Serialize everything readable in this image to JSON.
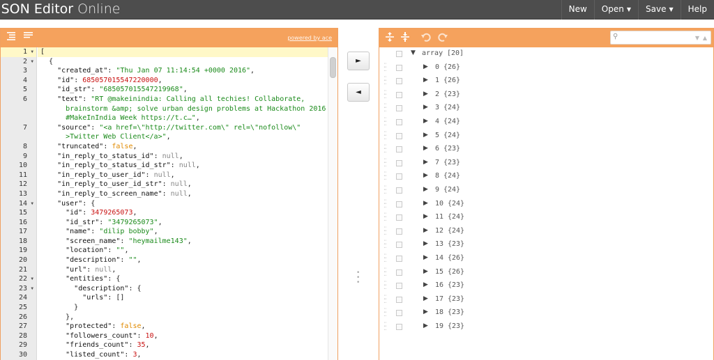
{
  "app": {
    "title_bold": "JSON Editor",
    "title_light": "Online"
  },
  "menu": {
    "new": "New",
    "open": "Open",
    "save": "Save",
    "help": "Help",
    "caret": "▼"
  },
  "left_panel": {
    "powered_by": "powered by ace",
    "line_numbers": [
      "1",
      "2",
      "3",
      "4",
      "5",
      "6",
      "",
      "",
      "7",
      "",
      "8",
      "9",
      "10",
      "11",
      "12",
      "13",
      "14",
      "15",
      "16",
      "17",
      "18",
      "19",
      "20",
      "21",
      "22",
      "23",
      "24",
      "25",
      "26",
      "27",
      "28",
      "29",
      "30"
    ],
    "folds": {
      "1": "▼",
      "2": "▼",
      "14": "▼",
      "22": "▼",
      "23": "▼"
    },
    "active_line": 1,
    "code": [
      [
        [
          "p",
          "["
        ]
      ],
      [
        [
          "p",
          "  {"
        ]
      ],
      [
        [
          "p",
          "    "
        ],
        [
          "k",
          "\"created_at\""
        ],
        [
          "p",
          ": "
        ],
        [
          "s",
          "\"Thu Jan 07 11:14:54 +0000 2016\""
        ],
        [
          "p",
          ","
        ]
      ],
      [
        [
          "p",
          "    "
        ],
        [
          "k",
          "\"id\""
        ],
        [
          "p",
          ": "
        ],
        [
          "n",
          "685057015547220000"
        ],
        [
          "p",
          ","
        ]
      ],
      [
        [
          "p",
          "    "
        ],
        [
          "k",
          "\"id_str\""
        ],
        [
          "p",
          ": "
        ],
        [
          "s",
          "\"685057015547219968\""
        ],
        [
          "p",
          ","
        ]
      ],
      [
        [
          "p",
          "    "
        ],
        [
          "k",
          "\"text\""
        ],
        [
          "p",
          ": "
        ],
        [
          "s",
          "\"RT @makeinindia: Calling all techies! Collaborate,"
        ]
      ],
      [
        [
          "s",
          "      brainstorm &amp; solve urban design problems at Hackathon 2016"
        ]
      ],
      [
        [
          "s",
          "      #MakeInIndia Week https://t.c…\""
        ],
        [
          "p",
          ","
        ]
      ],
      [
        [
          "p",
          "    "
        ],
        [
          "k",
          "\"source\""
        ],
        [
          "p",
          ": "
        ],
        [
          "s",
          "\"<a href=\\\"http://twitter.com\\\" rel=\\\"nofollow\\\""
        ]
      ],
      [
        [
          "s",
          "      >Twitter Web Client</a>\""
        ],
        [
          "p",
          ","
        ]
      ],
      [
        [
          "p",
          "    "
        ],
        [
          "k",
          "\"truncated\""
        ],
        [
          "p",
          ": "
        ],
        [
          "b",
          "false"
        ],
        [
          "p",
          ","
        ]
      ],
      [
        [
          "p",
          "    "
        ],
        [
          "k",
          "\"in_reply_to_status_id\""
        ],
        [
          "p",
          ": "
        ],
        [
          "nl",
          "null"
        ],
        [
          "p",
          ","
        ]
      ],
      [
        [
          "p",
          "    "
        ],
        [
          "k",
          "\"in_reply_to_status_id_str\""
        ],
        [
          "p",
          ": "
        ],
        [
          "nl",
          "null"
        ],
        [
          "p",
          ","
        ]
      ],
      [
        [
          "p",
          "    "
        ],
        [
          "k",
          "\"in_reply_to_user_id\""
        ],
        [
          "p",
          ": "
        ],
        [
          "nl",
          "null"
        ],
        [
          "p",
          ","
        ]
      ],
      [
        [
          "p",
          "    "
        ],
        [
          "k",
          "\"in_reply_to_user_id_str\""
        ],
        [
          "p",
          ": "
        ],
        [
          "nl",
          "null"
        ],
        [
          "p",
          ","
        ]
      ],
      [
        [
          "p",
          "    "
        ],
        [
          "k",
          "\"in_reply_to_screen_name\""
        ],
        [
          "p",
          ": "
        ],
        [
          "nl",
          "null"
        ],
        [
          "p",
          ","
        ]
      ],
      [
        [
          "p",
          "    "
        ],
        [
          "k",
          "\"user\""
        ],
        [
          "p",
          ": {"
        ]
      ],
      [
        [
          "p",
          "      "
        ],
        [
          "k",
          "\"id\""
        ],
        [
          "p",
          ": "
        ],
        [
          "n",
          "3479265073"
        ],
        [
          "p",
          ","
        ]
      ],
      [
        [
          "p",
          "      "
        ],
        [
          "k",
          "\"id_str\""
        ],
        [
          "p",
          ": "
        ],
        [
          "s",
          "\"3479265073\""
        ],
        [
          "p",
          ","
        ]
      ],
      [
        [
          "p",
          "      "
        ],
        [
          "k",
          "\"name\""
        ],
        [
          "p",
          ": "
        ],
        [
          "s",
          "\"dilip bobby\""
        ],
        [
          "p",
          ","
        ]
      ],
      [
        [
          "p",
          "      "
        ],
        [
          "k",
          "\"screen_name\""
        ],
        [
          "p",
          ": "
        ],
        [
          "s",
          "\"heymailme143\""
        ],
        [
          "p",
          ","
        ]
      ],
      [
        [
          "p",
          "      "
        ],
        [
          "k",
          "\"location\""
        ],
        [
          "p",
          ": "
        ],
        [
          "s",
          "\"\""
        ],
        [
          "p",
          ","
        ]
      ],
      [
        [
          "p",
          "      "
        ],
        [
          "k",
          "\"description\""
        ],
        [
          "p",
          ": "
        ],
        [
          "s",
          "\"\""
        ],
        [
          "p",
          ","
        ]
      ],
      [
        [
          "p",
          "      "
        ],
        [
          "k",
          "\"url\""
        ],
        [
          "p",
          ": "
        ],
        [
          "nl",
          "null"
        ],
        [
          "p",
          ","
        ]
      ],
      [
        [
          "p",
          "      "
        ],
        [
          "k",
          "\"entities\""
        ],
        [
          "p",
          ": {"
        ]
      ],
      [
        [
          "p",
          "        "
        ],
        [
          "k",
          "\"description\""
        ],
        [
          "p",
          ": {"
        ]
      ],
      [
        [
          "p",
          "          "
        ],
        [
          "k",
          "\"urls\""
        ],
        [
          "p",
          ": []"
        ]
      ],
      [
        [
          "p",
          "        }"
        ]
      ],
      [
        [
          "p",
          "      },"
        ]
      ],
      [
        [
          "p",
          "      "
        ],
        [
          "k",
          "\"protected\""
        ],
        [
          "p",
          ": "
        ],
        [
          "b",
          "false"
        ],
        [
          "p",
          ","
        ]
      ],
      [
        [
          "p",
          "      "
        ],
        [
          "k",
          "\"followers_count\""
        ],
        [
          "p",
          ": "
        ],
        [
          "n",
          "10"
        ],
        [
          "p",
          ","
        ]
      ],
      [
        [
          "p",
          "      "
        ],
        [
          "k",
          "\"friends_count\""
        ],
        [
          "p",
          ": "
        ],
        [
          "n",
          "35"
        ],
        [
          "p",
          ","
        ]
      ],
      [
        [
          "p",
          "      "
        ],
        [
          "k",
          "\"listed_count\""
        ],
        [
          "p",
          ": "
        ],
        [
          "n",
          "3"
        ],
        [
          "p",
          ","
        ]
      ]
    ]
  },
  "middle": {
    "copy_right": "►",
    "copy_left": "◄"
  },
  "right_panel": {
    "root": {
      "label": "array",
      "count": "[20]"
    },
    "items": [
      {
        "index": "0",
        "count": "{26}"
      },
      {
        "index": "1",
        "count": "{26}"
      },
      {
        "index": "2",
        "count": "{23}"
      },
      {
        "index": "3",
        "count": "{24}"
      },
      {
        "index": "4",
        "count": "{24}"
      },
      {
        "index": "5",
        "count": "{24}"
      },
      {
        "index": "6",
        "count": "{23}"
      },
      {
        "index": "7",
        "count": "{23}"
      },
      {
        "index": "8",
        "count": "{24}"
      },
      {
        "index": "9",
        "count": "{24}"
      },
      {
        "index": "10",
        "count": "{24}"
      },
      {
        "index": "11",
        "count": "{24}"
      },
      {
        "index": "12",
        "count": "{24}"
      },
      {
        "index": "13",
        "count": "{23}"
      },
      {
        "index": "14",
        "count": "{26}"
      },
      {
        "index": "15",
        "count": "{26}"
      },
      {
        "index": "16",
        "count": "{23}"
      },
      {
        "index": "17",
        "count": "{23}"
      },
      {
        "index": "18",
        "count": "{23}"
      },
      {
        "index": "19",
        "count": "{23}"
      }
    ],
    "search_placeholder": ""
  }
}
